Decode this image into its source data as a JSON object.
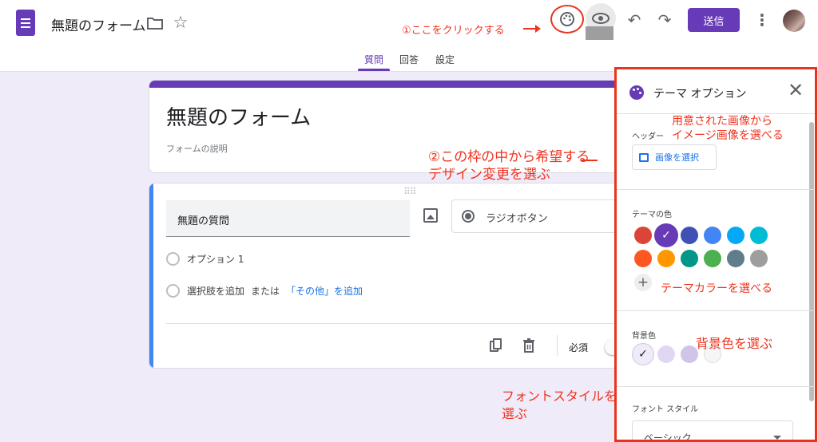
{
  "header": {
    "doc_title": "無題のフォーム",
    "send_label": "送信",
    "annotation_click": "①ここをクリックする",
    "icons": [
      "forms-logo",
      "folder-icon",
      "star-icon",
      "palette-icon",
      "eye-icon",
      "undo-icon",
      "redo-icon",
      "more-vert-icon",
      "avatar"
    ]
  },
  "tabs": [
    {
      "label": "質問",
      "active": true
    },
    {
      "label": "回答"
    },
    {
      "label": "設定"
    }
  ],
  "form": {
    "title": "無題のフォーム",
    "description_placeholder": "フォームの説明"
  },
  "question": {
    "title_placeholder": "無題の質問",
    "type_label": "ラジオボタン",
    "option_1": "オプション 1",
    "add_option": "選択肢を追加",
    "or_text": "または",
    "add_other": "「その他」を追加",
    "required_label": "必須"
  },
  "annotations": {
    "choose_design_line1": "②この枠の中から希望する",
    "choose_design_line2": "デザイン変更を選ぶ",
    "font_style_line1": "フォントスタイルを",
    "font_style_line2": "選ぶ",
    "header_image_line1": "用意された画像から",
    "header_image_line2": "イメージ画像を選べる",
    "theme_color": "テーマカラーを選べる",
    "bg_color": "背景色を選ぶ"
  },
  "theme_panel": {
    "title": "テーマ オプション",
    "header_label": "ヘッダー",
    "select_image_label": "画像を選択",
    "theme_color_label": "テーマの色",
    "theme_colors": [
      "#db4437",
      "#673ab7",
      "#3f51b5",
      "#4285f4",
      "#03a9f4",
      "#00bcd4",
      "#ff5722",
      "#ff9800",
      "#009688",
      "#4caf50",
      "#607d8b",
      "#9e9e9e"
    ],
    "selected_theme_color": "#673ab7",
    "background_label": "背景色",
    "background_colors": [
      "#f0ebf8",
      "#e1d7f2",
      "#d1c4e9",
      "#f6f6f6"
    ],
    "selected_background": "#f0ebf8",
    "font_style_label": "フォント スタイル",
    "font_style_value": "ベーシック"
  },
  "colors": {
    "accent": "#673ab7",
    "annotation": "#f0321e",
    "link": "#1a73e8"
  }
}
